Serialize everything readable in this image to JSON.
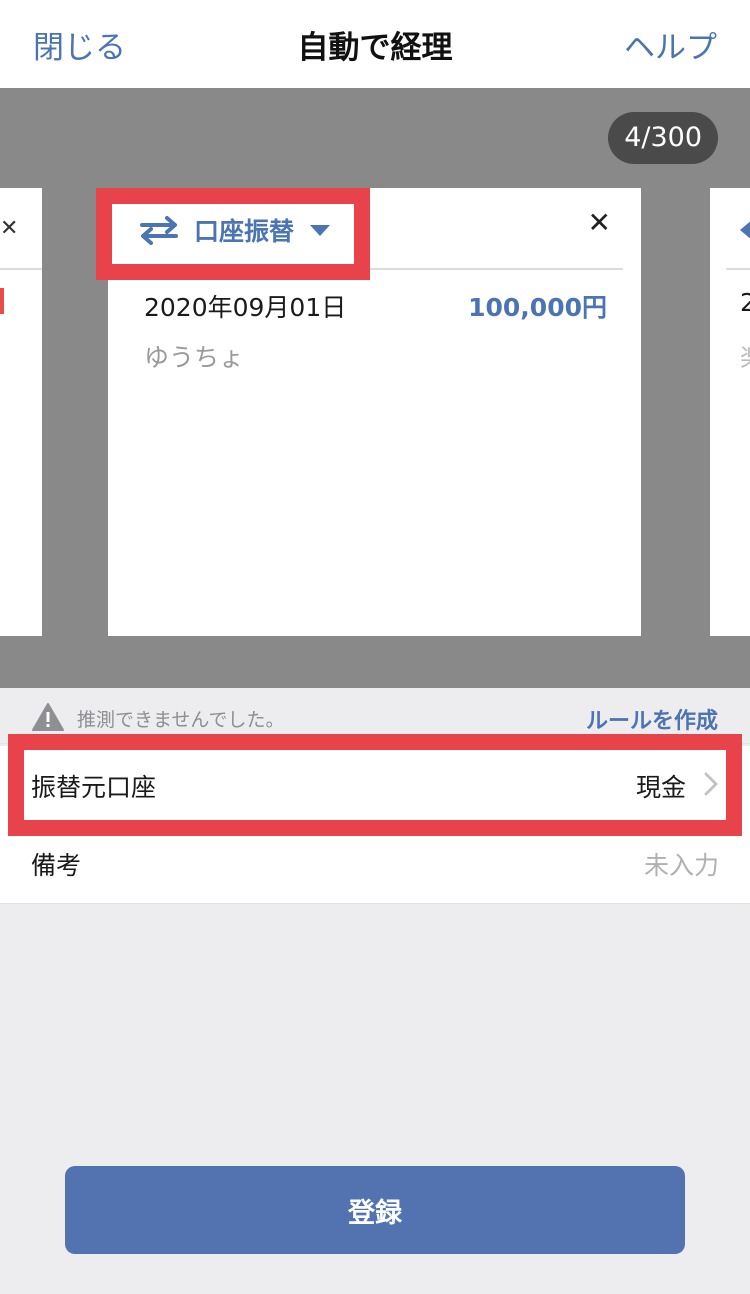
{
  "nav": {
    "close_label": "閉じる",
    "title": "自動で経理",
    "help_label": "ヘルプ"
  },
  "carousel": {
    "counter": "4/300",
    "card": {
      "type_label": "口座振替",
      "type_icon": "swap-arrows-icon",
      "date": "2020年09月01日",
      "amount": "100,000円",
      "account": "ゆうちょ"
    },
    "peek_right": {
      "date_fragment": "2",
      "account_fragment": "楽"
    }
  },
  "hint": {
    "message": "推測できませんでした。",
    "link_label": "ルールを作成"
  },
  "form": {
    "transfer_from": {
      "label": "振替元口座",
      "value": "現金"
    },
    "memo": {
      "label": "備考",
      "placeholder": "未入力"
    }
  },
  "submit_label": "登録",
  "colors": {
    "accent": "#4c74b3",
    "highlight": "#e8424a",
    "button": "#5273b0",
    "band": "#898989"
  }
}
